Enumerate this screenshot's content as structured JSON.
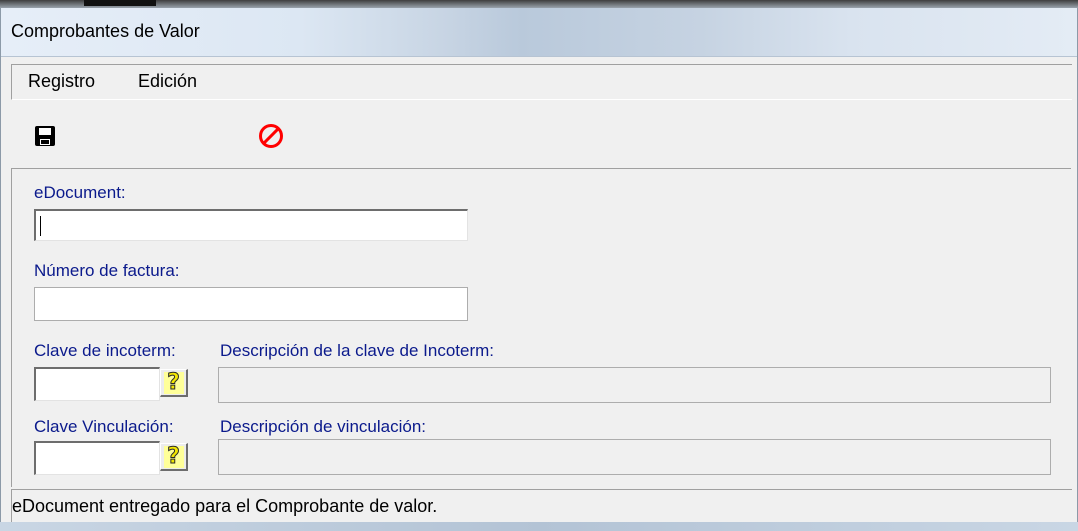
{
  "window": {
    "title": "Comprobantes de Valor"
  },
  "menu": {
    "items": [
      "Registro",
      "Edición"
    ]
  },
  "toolbar": {
    "save_icon": "floppy-disk-icon",
    "cancel_icon": "no-entry-icon",
    "cancel_color": "#ff0000"
  },
  "form": {
    "edocument": {
      "label": "eDocument:",
      "value": ""
    },
    "invoice_number": {
      "label": "Número de factura:",
      "value": ""
    },
    "incoterm": {
      "key_label": "Clave de incoterm:",
      "description_label": "Descripción de la clave de Incoterm:",
      "key_value": "",
      "description_value": "",
      "help_glyph": "?"
    },
    "vinculacion": {
      "key_label": "Clave Vinculación:",
      "description_label": "Descripción de vinculación:",
      "key_value": "",
      "description_value": "",
      "help_glyph": "?"
    }
  },
  "status": {
    "text": "eDocument entregado para el Comprobante de valor."
  }
}
